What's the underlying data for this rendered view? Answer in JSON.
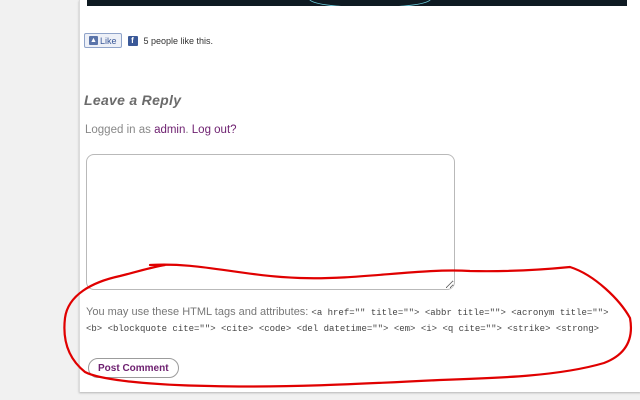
{
  "like_bar": {
    "like_label": "Like",
    "fb_glyph": "f",
    "count_text": "5 people like this."
  },
  "reply": {
    "title": "Leave a Reply",
    "logged_prefix": "Logged in as ",
    "user": "admin",
    "logout": "Log out?",
    "allowed_intro": "You may use these HTML tags and attributes: ",
    "allowed_tags": "<a href=\"\" title=\"\"> <abbr title=\"\"> <acronym title=\"\"> <b> <blockquote cite=\"\"> <cite> <code> <del datetime=\"\"> <em> <i> <q cite=\"\"> <strike> <strong>",
    "submit_label": "Post Comment"
  },
  "colors": {
    "link": "#6d1f6f",
    "annotation": "#e00000"
  }
}
